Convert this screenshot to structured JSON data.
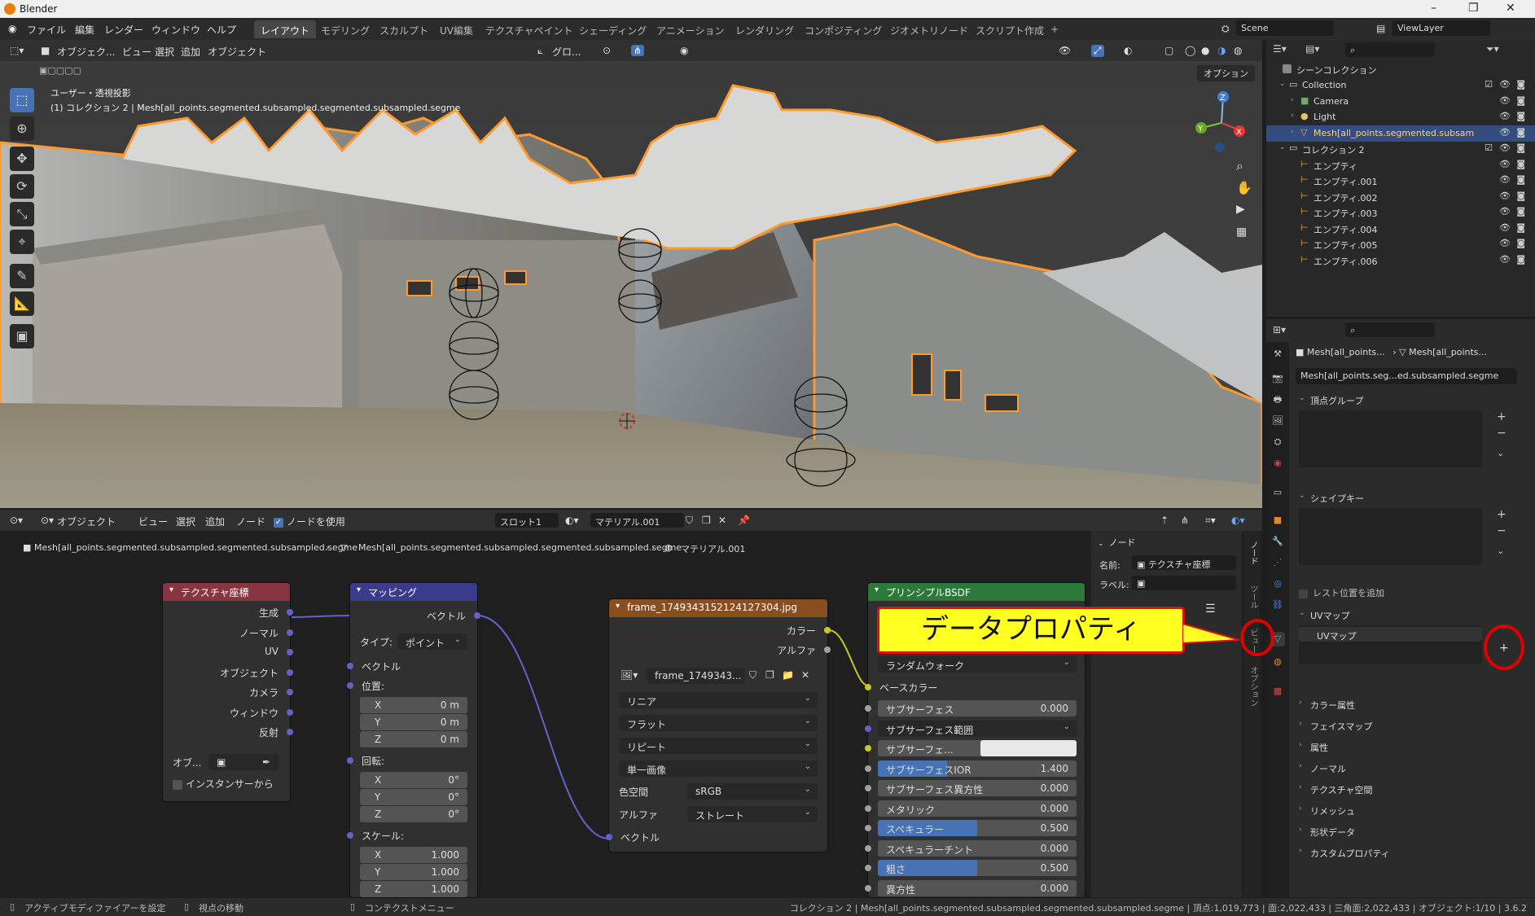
{
  "window": {
    "title": "Blender",
    "controls": [
      "–",
      "❐",
      "✕"
    ]
  },
  "menu": [
    "ファイル",
    "編集",
    "レンダー",
    "ウィンドウ",
    "ヘルプ"
  ],
  "workspaces": [
    "レイアウト",
    "モデリング",
    "スカルプト",
    "UV編集",
    "テクスチャペイント",
    "シェーディング",
    "アニメーション",
    "レンダリング",
    "コンポジティング",
    "ジオメトリノード",
    "スクリプト作成"
  ],
  "workspaces_add": "+",
  "scene_name": "Scene",
  "view_layer": "ViewLayer",
  "viewport": {
    "mode": "オブジェク...",
    "menus": [
      "ビュー",
      "選択",
      "追加",
      "オブジェクト"
    ],
    "transform_orientation": "グロ...",
    "options_label": "オプション",
    "overlay_text_1": "ユーザー・透視投影",
    "overlay_text_2": "(1) コレクション 2 | Mesh[all_points.segmented.subsampled.segmented.subsampled.segme"
  },
  "outliner": {
    "root": "シーンコレクション",
    "items": [
      {
        "label": "Collection",
        "indent": 1,
        "type": "collection"
      },
      {
        "label": "Camera",
        "indent": 2,
        "type": "camera"
      },
      {
        "label": "Light",
        "indent": 2,
        "type": "light"
      },
      {
        "label": "Mesh[all_points.segmented.subsam",
        "indent": 2,
        "type": "mesh",
        "selected": true
      },
      {
        "label": "コレクション 2",
        "indent": 1,
        "type": "collection"
      },
      {
        "label": "エンプティ",
        "indent": 2,
        "type": "empty"
      },
      {
        "label": "エンプティ.001",
        "indent": 2,
        "type": "empty"
      },
      {
        "label": "エンプティ.002",
        "indent": 2,
        "type": "empty"
      },
      {
        "label": "エンプティ.003",
        "indent": 2,
        "type": "empty"
      },
      {
        "label": "エンプティ.004",
        "indent": 2,
        "type": "empty"
      },
      {
        "label": "エンプティ.005",
        "indent": 2,
        "type": "empty"
      },
      {
        "label": "エンプティ.006",
        "indent": 2,
        "type": "empty"
      }
    ]
  },
  "properties": {
    "breadcrumb_object": "Mesh[all_points...",
    "breadcrumb_data": "Mesh[all_points...",
    "mesh_name": "Mesh[all_points.seg...ed.subsampled.segme",
    "panels": {
      "vertex_groups": "頂点グループ",
      "shape_keys": "シェイプキー",
      "rest_position": "レスト位置を追加",
      "uv_maps": "UVマップ",
      "uv_map_item": "UVマップ",
      "color_attributes": "カラー属性",
      "face_maps": "フェイスマップ",
      "attributes": "属性",
      "normals": "ノーマル",
      "texture_space": "テクスチャ空間",
      "remesh": "リメッシュ",
      "shape_data": "形状データ",
      "custom_props": "カスタムプロパティ"
    }
  },
  "node_editor": {
    "mode": "オブジェクト",
    "menus": [
      "ビュー",
      "選択",
      "追加",
      "ノード"
    ],
    "use_nodes": "ノードを使用",
    "slot": "スロット1",
    "material": "マテリアル.001",
    "breadcrumb": [
      "Mesh[all_points.segmented.subsampled.segmented.subsampled.segme",
      "Mesh[all_points.segmented.subsampled.segmented.subsampled.segme",
      "マテリアル.001"
    ],
    "nodes": {
      "texcoord": {
        "title": "テクスチャ座標",
        "outputs": [
          "生成",
          "ノーマル",
          "UV",
          "オブジェクト",
          "カメラ",
          "ウィンドウ",
          "反射"
        ],
        "object_label": "オブ...",
        "instancer": "インスタンサーから"
      },
      "mapping": {
        "title": "マッピング",
        "output": "ベクトル",
        "type_label": "タイプ:",
        "type_value": "ポイント",
        "vector": "ベクトル",
        "location": "位置:",
        "loc": [
          {
            "axis": "X",
            "value": "0 m"
          },
          {
            "axis": "Y",
            "value": "0 m"
          },
          {
            "axis": "Z",
            "value": "0 m"
          }
        ],
        "rotation": "回転:",
        "rot": [
          {
            "axis": "X",
            "value": "0°"
          },
          {
            "axis": "Y",
            "value": "0°"
          },
          {
            "axis": "Z",
            "value": "0°"
          }
        ],
        "scale": "スケール:",
        "scl": [
          {
            "axis": "X",
            "value": "1.000"
          },
          {
            "axis": "Y",
            "value": "1.000"
          },
          {
            "axis": "Z",
            "value": "1.000"
          }
        ]
      },
      "image": {
        "title": "frame_1749343152124127304.jpg",
        "out_color": "カラー",
        "out_alpha": "アルファ",
        "image_name": "frame_1749343...",
        "interp": "リニア",
        "projection": "フラット",
        "extension": "リピート",
        "source": "単一画像",
        "colorspace_label": "色空間",
        "colorspace_value": "sRGB",
        "alpha_label": "アルファ",
        "alpha_value": "ストレート",
        "in_vector": "ベクトル"
      },
      "bsdf": {
        "title": "プリンシプルBSDF",
        "subsurface_method": "ランダムウォーク",
        "base_color": "ベースカラー",
        "fields": [
          {
            "label": "サブサーフェス",
            "value": "0.000",
            "fill": 0
          },
          {
            "label": "サブサーフェス範囲",
            "value": "",
            "dropdown": true
          },
          {
            "label": "サブサーフェ...",
            "value": "",
            "color": true
          },
          {
            "label": "サブサーフェスIOR",
            "value": "1.400",
            "fill": 0.35
          },
          {
            "label": "サブサーフェス異方性",
            "value": "0.000",
            "fill": 0
          },
          {
            "label": "メタリック",
            "value": "0.000",
            "fill": 0
          },
          {
            "label": "スペキュラー",
            "value": "0.500",
            "fill": 0.5
          },
          {
            "label": "スペキュラーチント",
            "value": "0.000",
            "fill": 0
          },
          {
            "label": "粗さ",
            "value": "0.500",
            "fill": 0.5
          },
          {
            "label": "異方性",
            "value": "0.000",
            "fill": 0
          }
        ]
      }
    },
    "sidebar": {
      "section": "ノード",
      "name_label": "名前:",
      "name_value": "テクスチャ座標",
      "label_label": "ラベル:",
      "tabs": [
        "ノード",
        "ツール",
        "ビュー",
        "オプション"
      ]
    }
  },
  "annotation": {
    "callout": "データプロパティ"
  },
  "statusbar": {
    "left_1": "アクティブモディファイアーを設定",
    "left_2": "視点の移動",
    "left_3": "コンテクストメニュー",
    "right": "コレクション 2 | Mesh[all_points.segmented.subsampled.segmented.subsampled.segme | 頂点:1,019,773 | 面:2,022,433 | 三角面:2,022,433 | オブジェクト:1/10 | 3.6.2"
  },
  "colors": {
    "accent": "#4772b3",
    "selection": "#ffa033",
    "texcoord_header": "#873641",
    "mapping_header": "#3b3b8e",
    "image_header": "#8a4d1f",
    "bsdf_header": "#2c7a3a"
  }
}
